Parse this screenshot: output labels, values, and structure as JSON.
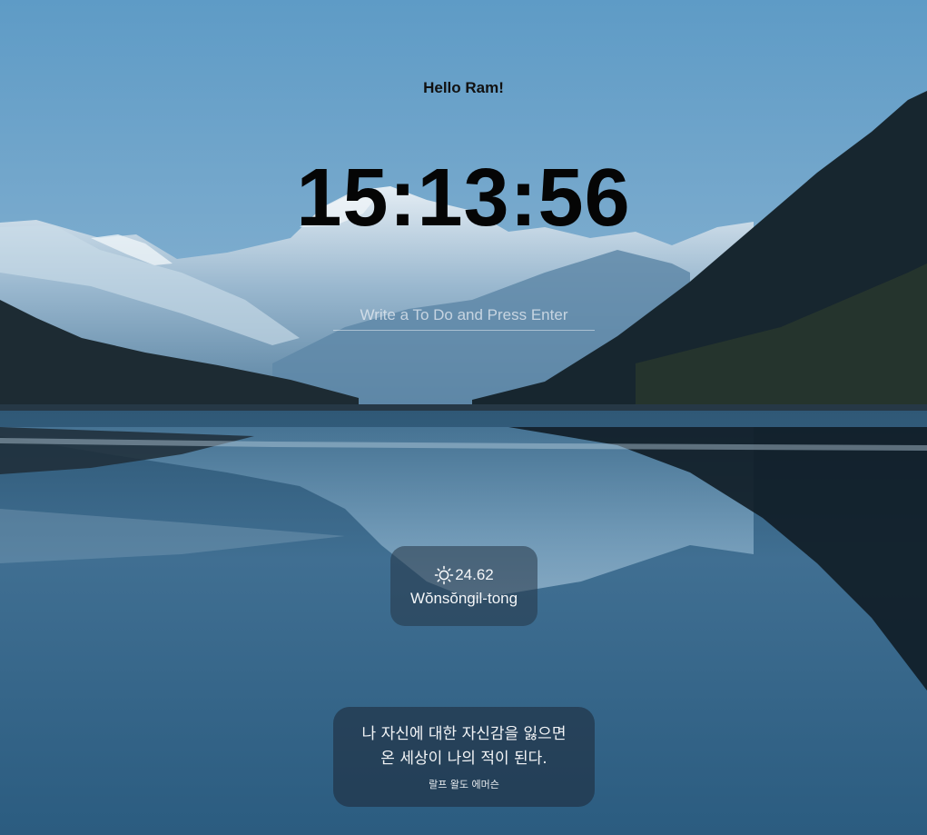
{
  "greeting": "Hello Ram!",
  "clock": "15:13:56",
  "todo": {
    "placeholder": "Write a To Do and Press Enter"
  },
  "weather": {
    "icon": "sun-icon",
    "temperature": "24.62",
    "city": "Wŏnsŏngil-tong"
  },
  "quote": {
    "text_line1": "나 자신에 대한 자신감을 잃으면",
    "text_line2": "온 세상이 나의 적이 된다.",
    "author": "랄프 왈도 에머슨"
  }
}
